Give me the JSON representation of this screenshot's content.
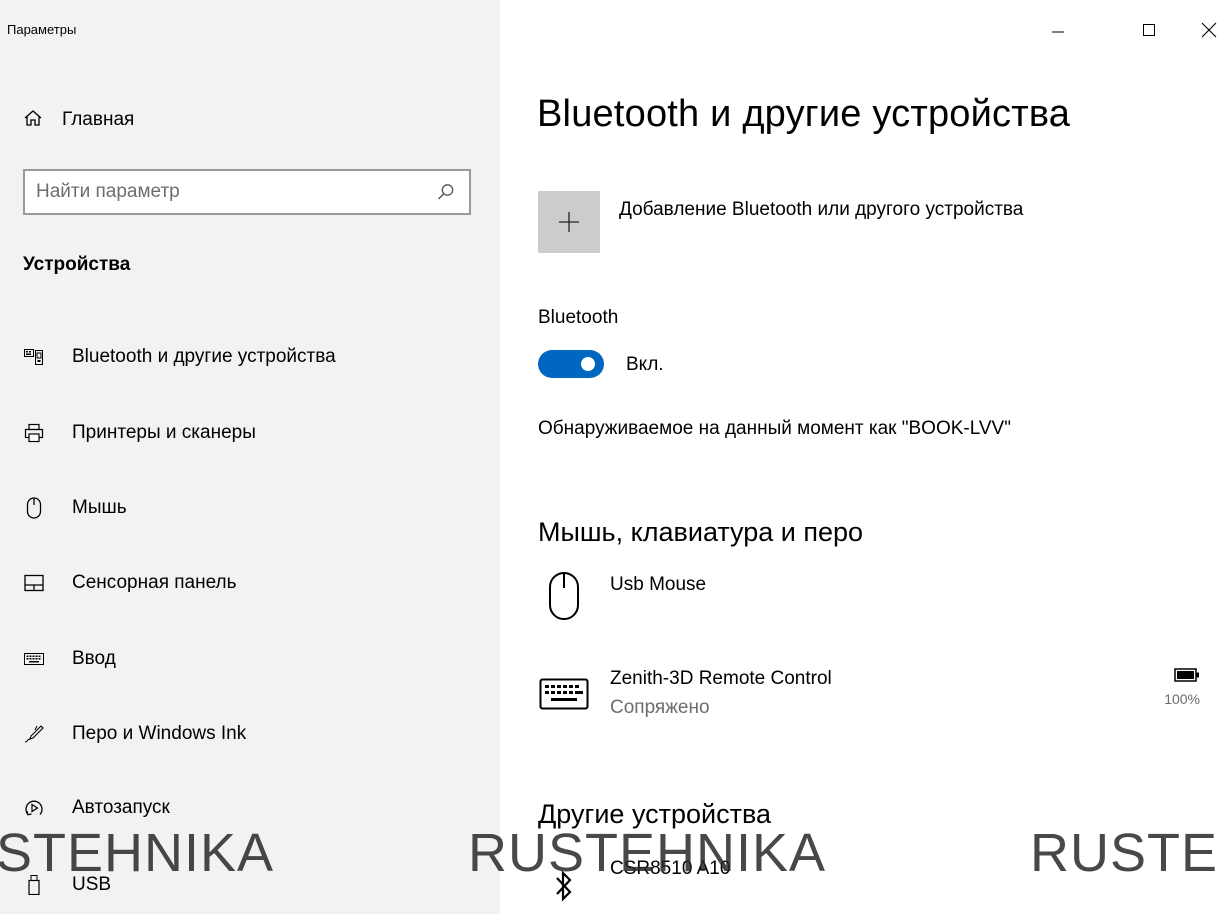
{
  "window": {
    "title": "Параметры",
    "controls": {
      "minimize": "—",
      "maximize": "☐",
      "close": "✕"
    }
  },
  "sidebar": {
    "home_label": "Главная",
    "search_placeholder": "Найти параметр",
    "section_title": "Устройства",
    "items": [
      {
        "label": "Bluetooth и другие устройства",
        "icon": "bluetooth-devices-icon"
      },
      {
        "label": "Принтеры и сканеры",
        "icon": "printer-icon"
      },
      {
        "label": "Мышь",
        "icon": "mouse-icon"
      },
      {
        "label": "Сенсорная панель",
        "icon": "touchpad-icon"
      },
      {
        "label": "Ввод",
        "icon": "keyboard-icon"
      },
      {
        "label": "Перо и Windows Ink",
        "icon": "pen-icon"
      },
      {
        "label": "Автозапуск",
        "icon": "autoplay-icon"
      },
      {
        "label": "USB",
        "icon": "usb-icon"
      }
    ]
  },
  "main": {
    "page_title": "Bluetooth и другие устройства",
    "add_device_label": "Добавление Bluetooth или другого устройства",
    "bluetooth_label": "Bluetooth",
    "toggle_state": "Вкл.",
    "discoverable_text": "Обнаруживаемое на данный момент как \"BOOK-LVV\"",
    "groups": {
      "input_devices_title": "Мышь, клавиатура и перо",
      "other_devices_title": "Другие устройства"
    },
    "devices": [
      {
        "name": "Usb Mouse",
        "status": "",
        "icon": "mouse-icon"
      },
      {
        "name": "Zenith-3D Remote Control",
        "status": "Сопряжено",
        "icon": "keyboard-icon",
        "battery": "100%"
      },
      {
        "name": "CSR8510 A10",
        "status": "",
        "icon": "bluetooth-icon"
      }
    ]
  },
  "watermark": {
    "left": "STEHNIKA",
    "middle": "RUSTEHNIKA",
    "right": "RUSTE"
  },
  "colors": {
    "accent": "#0067c0",
    "sidebar_bg": "#f2f2f2",
    "add_button_bg": "#cccccc"
  }
}
